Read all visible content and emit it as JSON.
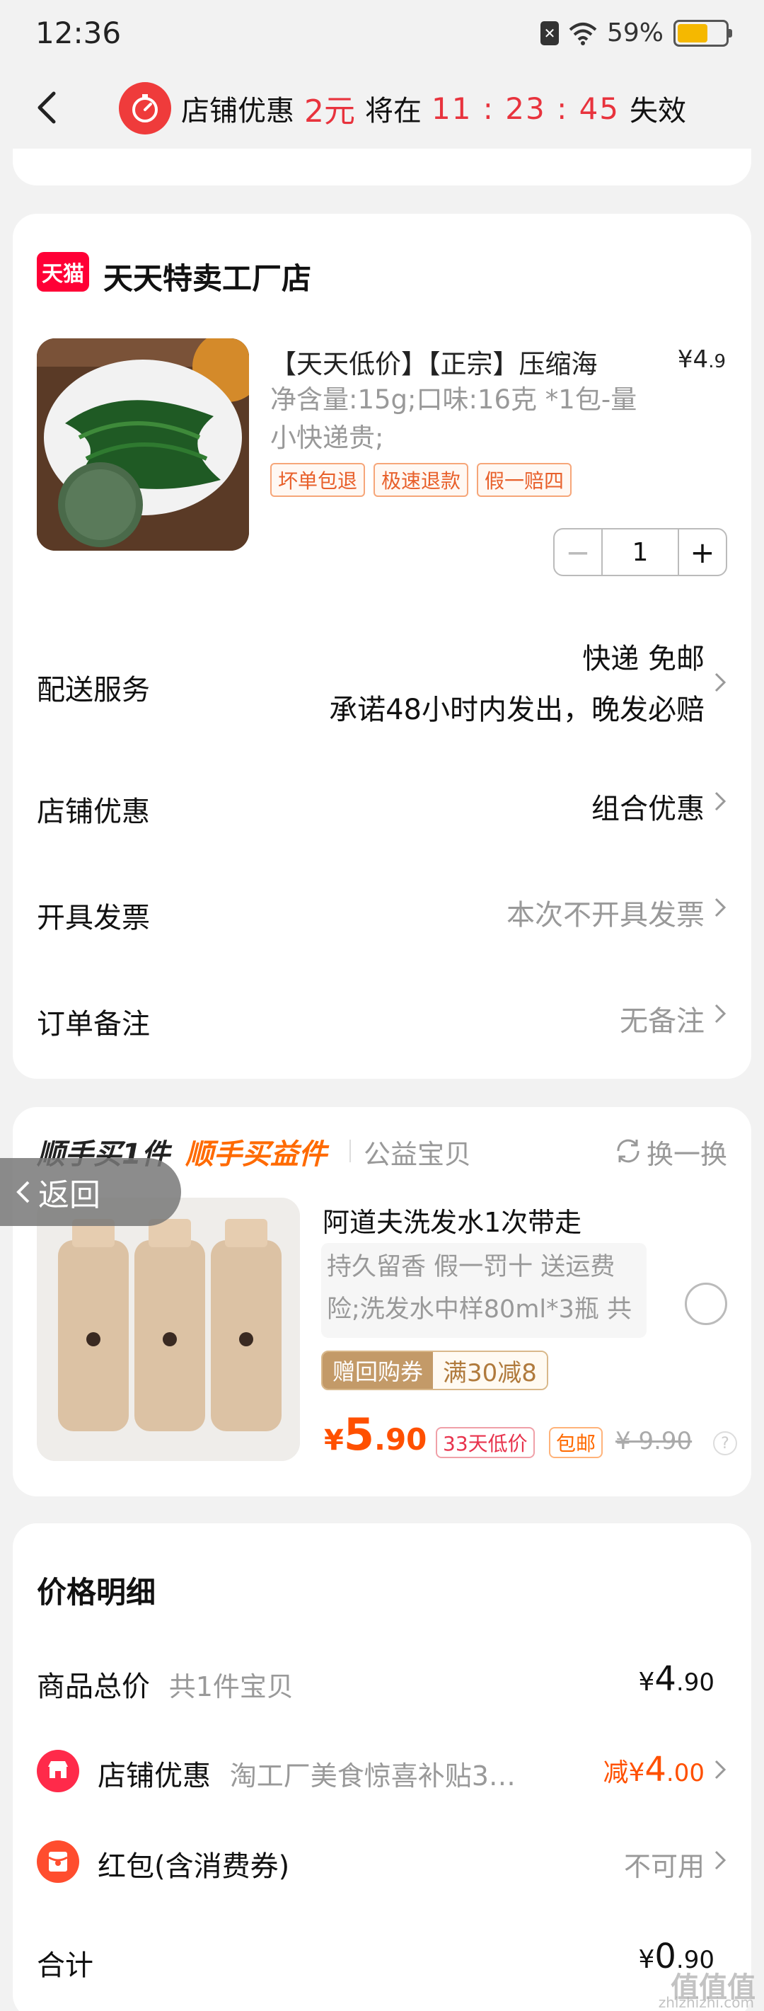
{
  "status_bar": {
    "time": "12:36",
    "battery": "59%",
    "sim_icon": "sim-off-icon",
    "wifi_icon": "wifi-icon"
  },
  "nav": {
    "promo_prefix": "店铺优惠",
    "promo_amount": "2元",
    "promo_mid": "将在",
    "promo_time": "11 : 23 : 45",
    "promo_suffix": "失效",
    "accent_color": "#e8333d"
  },
  "shop": {
    "logo_text": "天猫",
    "name": "天天特卖工厂店"
  },
  "product": {
    "title": "【天天低价】【正宗】压缩海",
    "price_symbol": "¥",
    "price_int": "4",
    "price_dec": ".9",
    "spec_line1": "净含量:15g;口味:16克 *1包-量",
    "spec_line2": "小快递贵;",
    "tags": [
      "坏单包退",
      "极速退款",
      "假一赔四"
    ],
    "quantity": "1",
    "minus": "−",
    "plus": "+"
  },
  "rows": {
    "delivery_label": "配送服务",
    "delivery_value1": "快递 免邮",
    "delivery_value2": "承诺48小时内发出，晚发必赔",
    "discount_label": "店铺优惠",
    "discount_value": "组合优惠",
    "invoice_label": "开具发票",
    "invoice_value": "本次不开具发票",
    "note_label": "订单备注",
    "note_value": "无备注"
  },
  "side_buy": {
    "title1": "顺手买1件",
    "title2": "顺手买益件",
    "title3": "公益宝贝",
    "swap": "换一换",
    "item_title": "阿道夫洗发水1次带走",
    "item_desc": "持久留香 假一罚十 送运费险;洗发水中样80ml*3瓶 共",
    "coupon_a": "赠回购券",
    "coupon_b": "满30减8",
    "price_symbol": "¥",
    "price_int": "5",
    "price_dec": ".90",
    "pill_low": "33天低价",
    "pill_free": "包邮",
    "original_price": "¥ 9.90",
    "help": "?"
  },
  "return_button": "返回",
  "price_detail": {
    "title": "价格明细",
    "goods_label": "商品总价",
    "goods_sub": "共1件宝贝",
    "goods_symbol": "¥",
    "goods_int": "4",
    "goods_dec": ".90",
    "shop_disc_label": "店铺优惠",
    "shop_disc_sub": "淘工厂美食惊喜补贴3…",
    "shop_disc_prefix": "减",
    "shop_disc_symbol": "¥",
    "shop_disc_int": "4",
    "shop_disc_dec": ".00",
    "redpack_label": "红包(含消费券)",
    "redpack_value": "不可用",
    "total_label": "合计",
    "total_symbol": "¥",
    "total_int": "0",
    "total_dec": ".90"
  },
  "watermark": {
    "text": "值值值",
    "sub": "zhizhizhi.com"
  }
}
